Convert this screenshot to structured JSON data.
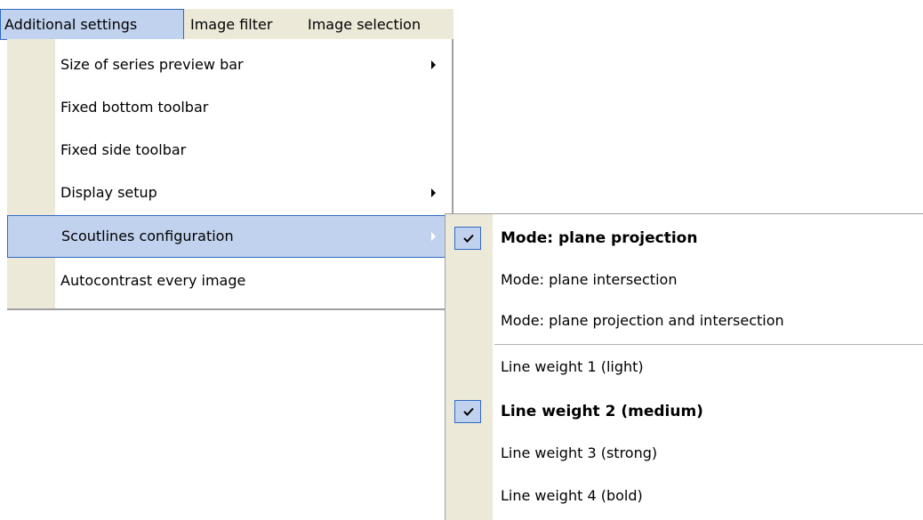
{
  "menubar": {
    "items": [
      {
        "label": "Additional settings"
      },
      {
        "label": "Image filter"
      },
      {
        "label": "Image selection"
      }
    ]
  },
  "main_menu": {
    "items": [
      {
        "label": "Size of series preview bar",
        "has_submenu": true
      },
      {
        "label": "Fixed bottom toolbar",
        "has_submenu": false
      },
      {
        "label": "Fixed side toolbar",
        "has_submenu": false
      },
      {
        "label": "Display setup",
        "has_submenu": true
      },
      {
        "label": "Scoutlines configuration",
        "has_submenu": true,
        "highlighted": true
      },
      {
        "label": "Autocontrast every image",
        "has_submenu": false
      }
    ]
  },
  "submenu": {
    "items": [
      {
        "label": "Mode: plane projection",
        "checked": true
      },
      {
        "label": "Mode: plane intersection",
        "checked": false
      },
      {
        "label": "Mode: plane projection and intersection",
        "checked": false
      },
      {
        "label": "Line weight 1 (light)",
        "checked": false
      },
      {
        "label": "Line weight 2 (medium)",
        "checked": true
      },
      {
        "label": "Line weight 3 (strong)",
        "checked": false
      },
      {
        "label": "Line weight 4 (bold)",
        "checked": false
      }
    ]
  },
  "icons": {
    "submenu_arrow": "chevron-right-icon",
    "checked": "checkmark-icon"
  },
  "colors": {
    "menu_bg": "#ece9d8",
    "highlight_bg": "#c1d2ee",
    "highlight_border": "#316ac5"
  }
}
